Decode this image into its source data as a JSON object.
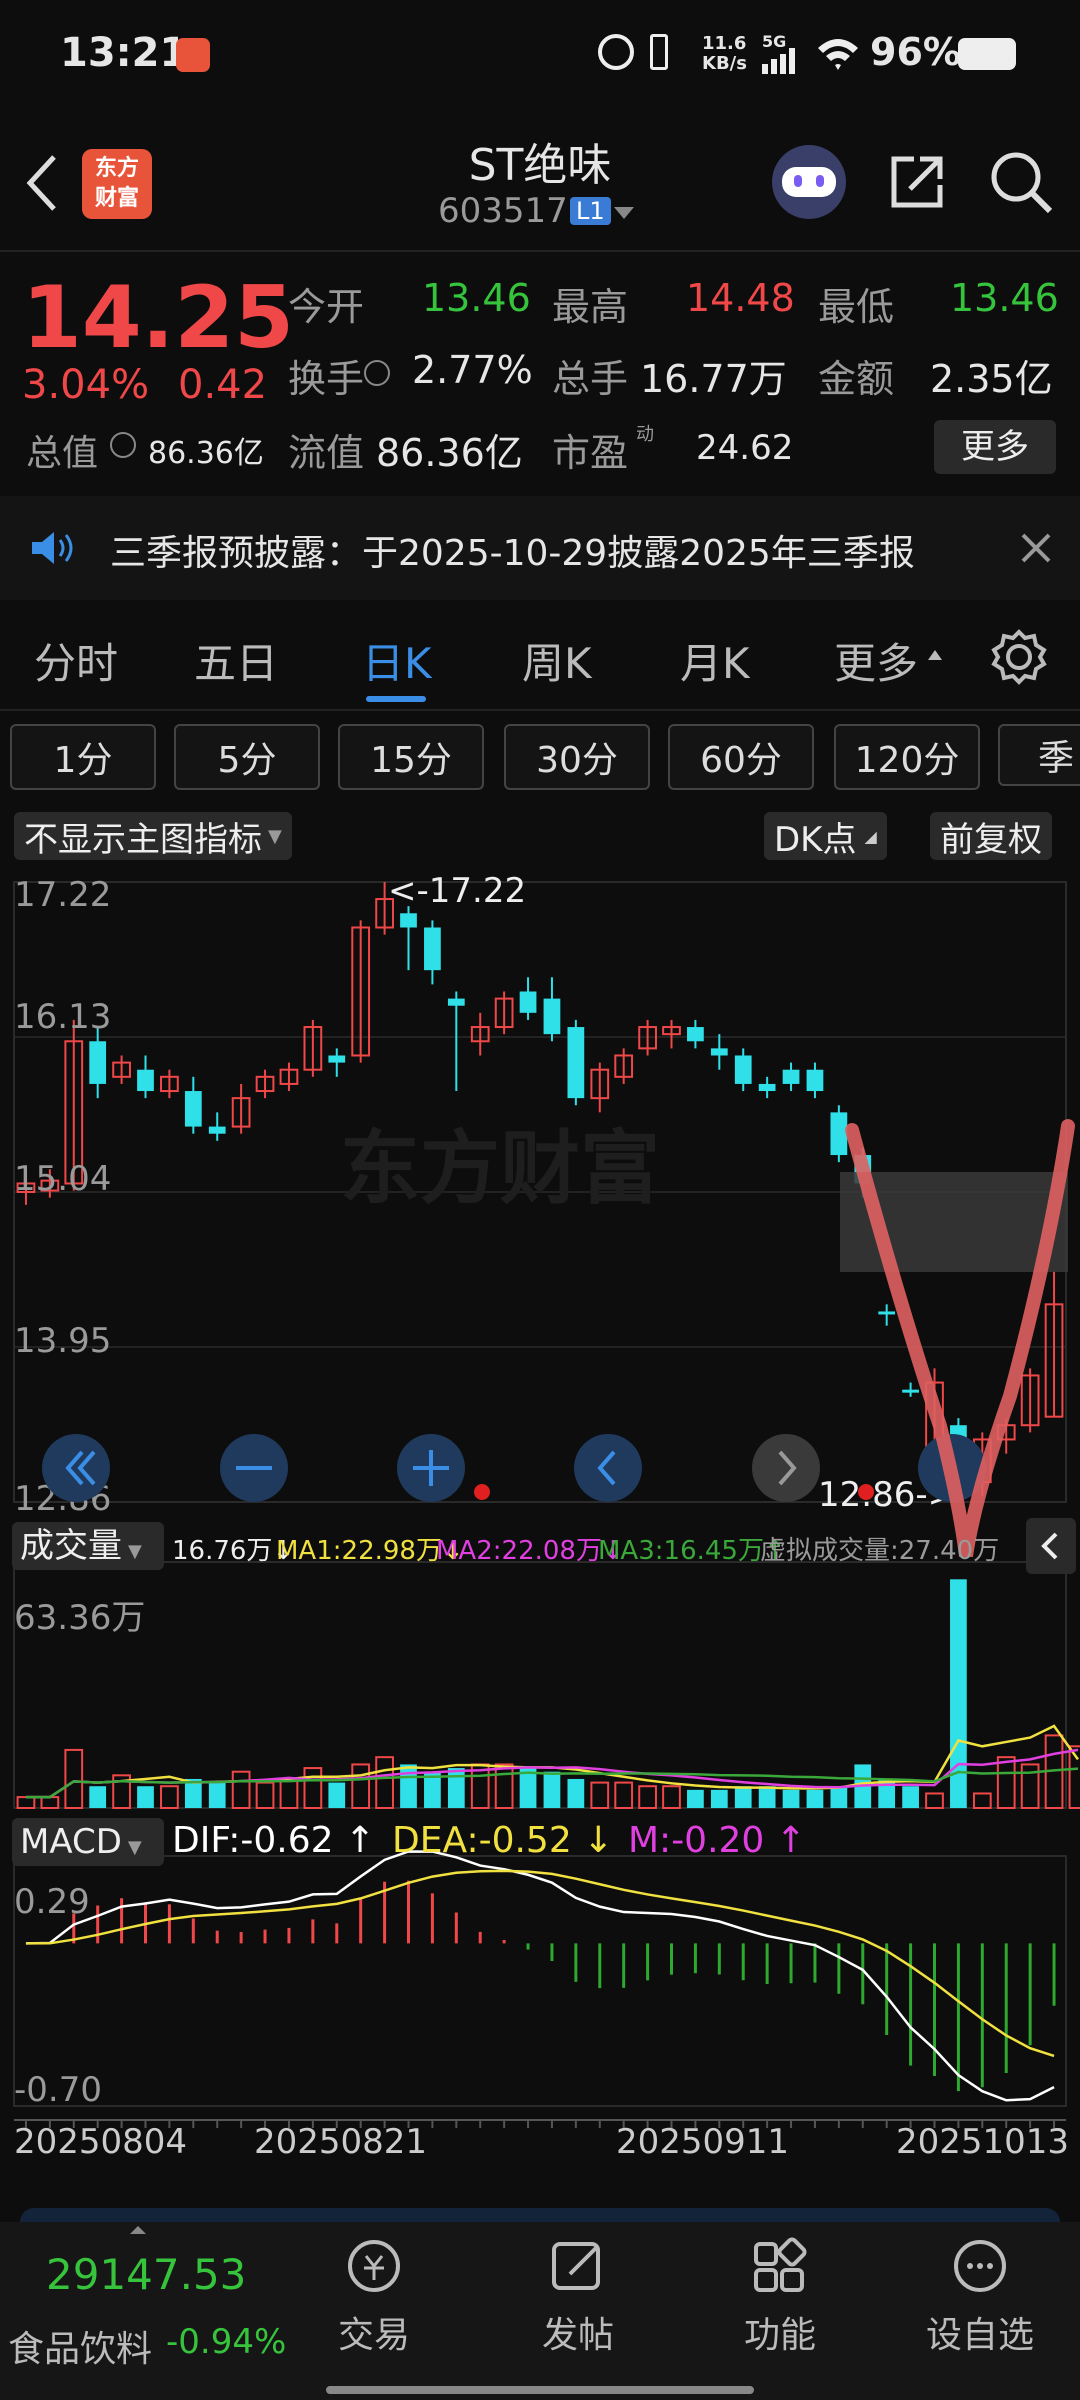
{
  "status_bar": {
    "time": "13:21",
    "net_speed_top": "11.6",
    "net_speed_bottom": "KB/s",
    "signal": "5G",
    "battery": "96%"
  },
  "header": {
    "logo_line1": "东方",
    "logo_line2": "财富",
    "title": "ST绝味",
    "code": "603517",
    "level": "L1"
  },
  "quote": {
    "price": "14.25",
    "change_pct": "3.04%",
    "change_amt": "0.42",
    "open_label": "今开",
    "open": "13.46",
    "high_label": "最高",
    "high": "14.48",
    "low_label": "最低",
    "low": "13.46",
    "turnover_label": "换手",
    "turnover": "2.77%",
    "volume_label": "总手",
    "volume": "16.77万",
    "amount_label": "金额",
    "amount": "2.35亿",
    "mktcap_label": "总值",
    "mktcap": "86.36亿",
    "float_label": "流值",
    "float": "86.36亿",
    "pe_label": "市盈",
    "pe_sup": "动",
    "pe": "24.62",
    "more": "更多"
  },
  "notice": {
    "text": "三季报预披露：于2025-10-29披露2025年三季报"
  },
  "tabs": [
    "分时",
    "五日",
    "日K",
    "周K",
    "月K",
    "更多"
  ],
  "periods": [
    "1分",
    "5分",
    "15分",
    "30分",
    "60分",
    "120分",
    "季"
  ],
  "chart_toolbar": {
    "indicator": "不显示主图指标",
    "dk": "DK点",
    "adjust": "前复权"
  },
  "kline": {
    "y_ticks": [
      "17.22",
      "16.13",
      "15.04",
      "13.95",
      "12.86"
    ],
    "high_marker": "<-17.22",
    "low_marker": "12.86->",
    "watermark": "东方财富"
  },
  "volume": {
    "label": "成交量",
    "vol": "16.76万",
    "ma1": "MA1:22.98万",
    "ma2": "MA2:22.08万",
    "ma3": "MA3:16.45万",
    "virtual": "虚拟成交量:27.40万",
    "max": "63.36万"
  },
  "macd": {
    "label": "MACD",
    "dif": "DIF:-0.62",
    "dea": "DEA:-0.52",
    "m": "M:-0.20",
    "top": "0.29",
    "bottom": "-0.70"
  },
  "dates": [
    "20250804",
    "20250821",
    "20250911",
    "20251013"
  ],
  "bottom_nav": {
    "index_value": "29147.53",
    "index_name": "食品饮料",
    "index_change": "-0.94%",
    "items": [
      "交易",
      "发帖",
      "功能",
      "设自选"
    ]
  },
  "colors": {
    "up": "#f04848",
    "down": "#2fe0e8",
    "ma1": "#f0e040",
    "ma2": "#e040e0",
    "ma3": "#3aa83a",
    "dif": "#ffffff",
    "dea": "#f0e040",
    "annotation": "#e06060"
  },
  "chart_data": {
    "type": "candlestick",
    "dates_shown": [
      "20250804",
      "20250821",
      "20250911",
      "20251013"
    ],
    "ylim": [
      12.86,
      17.22
    ],
    "candles": [
      {
        "o": 15.04,
        "c": 15.1,
        "h": 15.15,
        "l": 14.95
      },
      {
        "o": 15.05,
        "c": 15.12,
        "h": 15.2,
        "l": 15.0
      },
      {
        "o": 15.1,
        "c": 16.1,
        "h": 16.25,
        "l": 15.05
      },
      {
        "o": 16.1,
        "c": 15.8,
        "h": 16.2,
        "l": 15.7
      },
      {
        "o": 15.85,
        "c": 15.95,
        "h": 16.0,
        "l": 15.8
      },
      {
        "o": 15.9,
        "c": 15.75,
        "h": 16.0,
        "l": 15.7
      },
      {
        "o": 15.75,
        "c": 15.85,
        "h": 15.9,
        "l": 15.7
      },
      {
        "o": 15.75,
        "c": 15.5,
        "h": 15.85,
        "l": 15.45
      },
      {
        "o": 15.5,
        "c": 15.45,
        "h": 15.6,
        "l": 15.4
      },
      {
        "o": 15.5,
        "c": 15.7,
        "h": 15.8,
        "l": 15.45
      },
      {
        "o": 15.75,
        "c": 15.85,
        "h": 15.9,
        "l": 15.7
      },
      {
        "o": 15.8,
        "c": 15.9,
        "h": 15.95,
        "l": 15.75
      },
      {
        "o": 15.9,
        "c": 16.2,
        "h": 16.25,
        "l": 15.85
      },
      {
        "o": 16.0,
        "c": 15.95,
        "h": 16.05,
        "l": 15.85
      },
      {
        "o": 16.0,
        "c": 16.9,
        "h": 16.95,
        "l": 15.95
      },
      {
        "o": 16.9,
        "c": 17.1,
        "h": 17.22,
        "l": 16.85
      },
      {
        "o": 17.0,
        "c": 16.9,
        "h": 17.05,
        "l": 16.6
      },
      {
        "o": 16.9,
        "c": 16.6,
        "h": 16.95,
        "l": 16.5
      },
      {
        "o": 16.4,
        "c": 16.35,
        "h": 16.45,
        "l": 15.75
      },
      {
        "o": 16.1,
        "c": 16.2,
        "h": 16.3,
        "l": 16.0
      },
      {
        "o": 16.2,
        "c": 16.4,
        "h": 16.45,
        "l": 16.15
      },
      {
        "o": 16.45,
        "c": 16.3,
        "h": 16.55,
        "l": 16.25
      },
      {
        "o": 16.4,
        "c": 16.15,
        "h": 16.55,
        "l": 16.1
      },
      {
        "o": 16.2,
        "c": 15.7,
        "h": 16.25,
        "l": 15.65
      },
      {
        "o": 15.7,
        "c": 15.9,
        "h": 15.95,
        "l": 15.6
      },
      {
        "o": 15.85,
        "c": 16.0,
        "h": 16.05,
        "l": 15.8
      },
      {
        "o": 16.05,
        "c": 16.2,
        "h": 16.25,
        "l": 16.0
      },
      {
        "o": 16.15,
        "c": 16.2,
        "h": 16.25,
        "l": 16.05
      },
      {
        "o": 16.2,
        "c": 16.1,
        "h": 16.25,
        "l": 16.05
      },
      {
        "o": 16.05,
        "c": 16.0,
        "h": 16.15,
        "l": 15.9
      },
      {
        "o": 16.0,
        "c": 15.8,
        "h": 16.05,
        "l": 15.75
      },
      {
        "o": 15.8,
        "c": 15.75,
        "h": 15.85,
        "l": 15.7
      },
      {
        "o": 15.9,
        "c": 15.8,
        "h": 15.95,
        "l": 15.75
      },
      {
        "o": 15.9,
        "c": 15.75,
        "h": 15.95,
        "l": 15.7
      },
      {
        "o": 15.6,
        "c": 15.3,
        "h": 15.65,
        "l": 15.25
      },
      {
        "o": 15.3,
        "c": 15.1,
        "h": 15.35,
        "l": 15.0
      },
      {
        "o": 14.2,
        "c": 14.18,
        "h": 14.25,
        "l": 14.1
      },
      {
        "o": 13.65,
        "c": 13.63,
        "h": 13.7,
        "l": 13.6
      },
      {
        "o": 13.2,
        "c": 13.7,
        "h": 13.8,
        "l": 13.1
      },
      {
        "o": 13.4,
        "c": 13.15,
        "h": 13.45,
        "l": 12.86
      },
      {
        "o": 13.0,
        "c": 13.3,
        "h": 13.35,
        "l": 12.9
      },
      {
        "o": 13.3,
        "c": 13.4,
        "h": 13.45,
        "l": 13.2
      },
      {
        "o": 13.4,
        "c": 13.75,
        "h": 13.8,
        "l": 13.35
      },
      {
        "o": 13.46,
        "c": 14.25,
        "h": 14.48,
        "l": 13.46
      }
    ],
    "volume_ylim": [
      0,
      63.36
    ],
    "volume": [
      3,
      3,
      16,
      6,
      9,
      6,
      6,
      8,
      7,
      10,
      7,
      8,
      11,
      7,
      12,
      14,
      12,
      10,
      11,
      12,
      12,
      11,
      10,
      8,
      7,
      7,
      6,
      6,
      5,
      5,
      6,
      6,
      5,
      5,
      6,
      12,
      8,
      6,
      4,
      63,
      4,
      14,
      12,
      20,
      17
    ],
    "macd_ylim": [
      -0.7,
      0.29
    ]
  }
}
